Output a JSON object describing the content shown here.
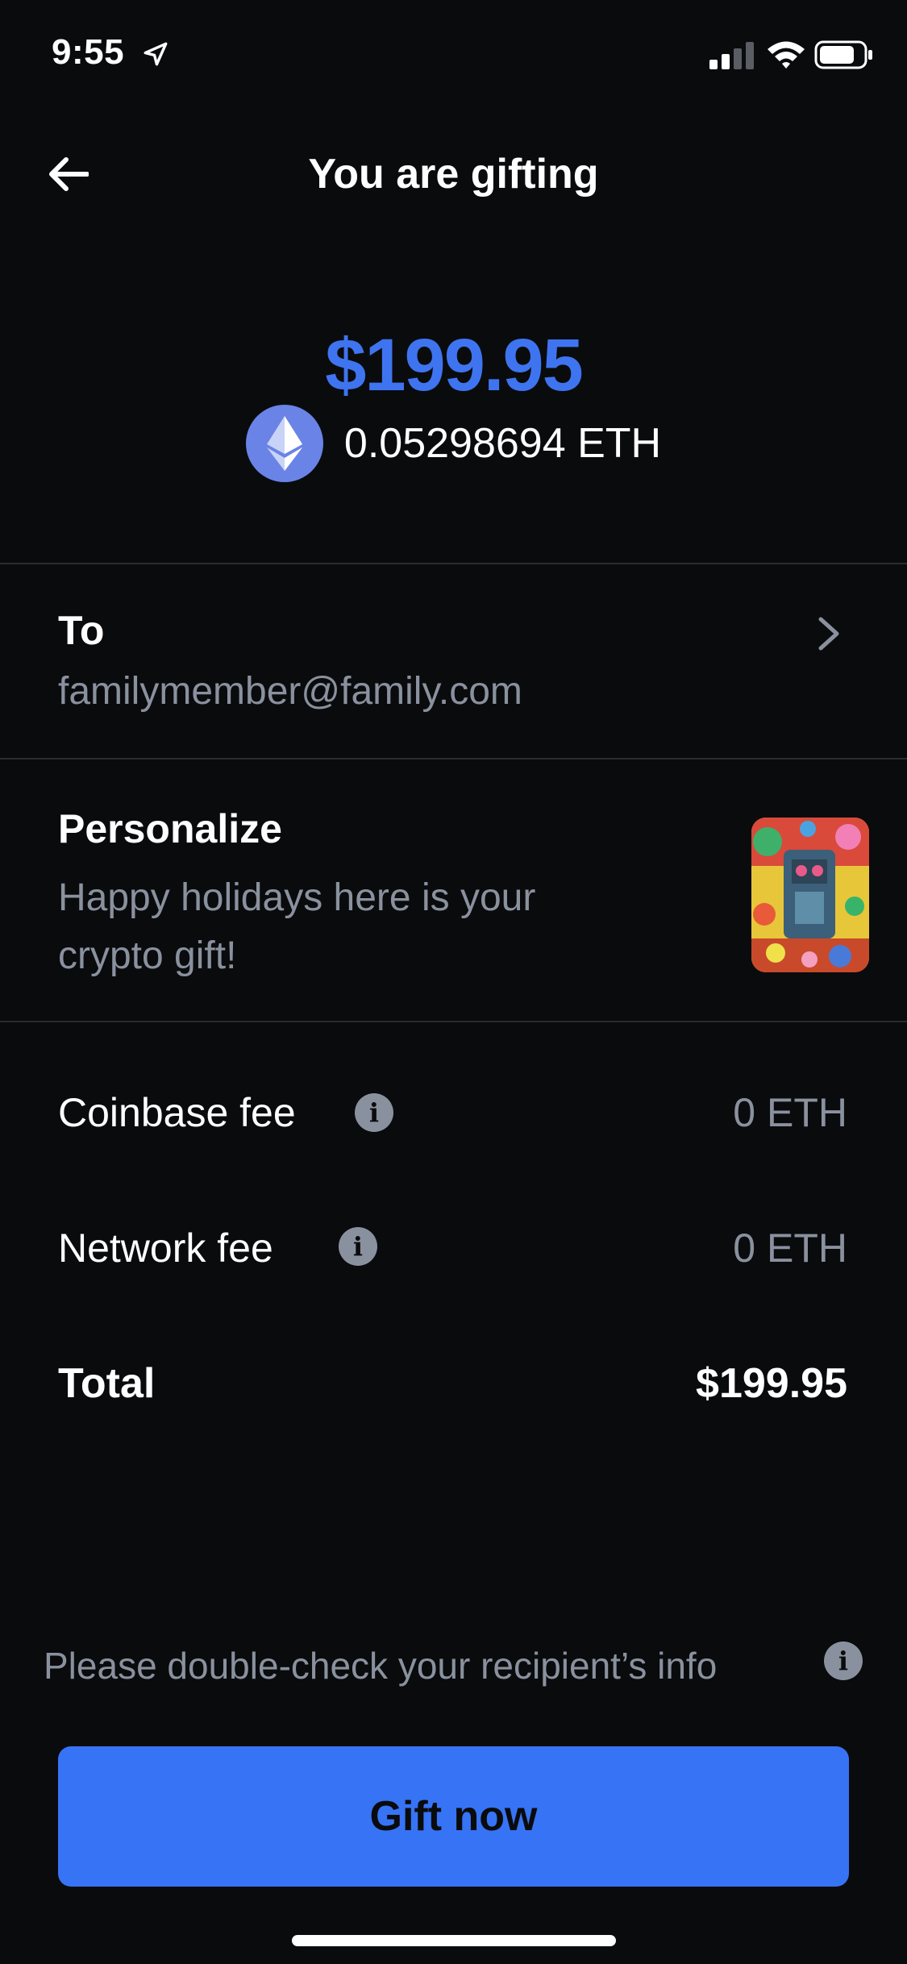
{
  "status_bar": {
    "time": "9:55"
  },
  "header": {
    "title": "You are gifting"
  },
  "amount": {
    "fiat": "$199.95",
    "crypto": "0.05298694 ETH",
    "crypto_icon": "ethereum-icon"
  },
  "recipient": {
    "label": "To",
    "value": "familymember@family.com"
  },
  "personalize": {
    "label": "Personalize",
    "message_line1": "Happy holidays here is your",
    "message_line2": "crypto gift!"
  },
  "fees": {
    "coinbase_label": "Coinbase fee",
    "coinbase_value": "0 ETH",
    "network_label": "Network fee",
    "network_value": "0 ETH",
    "total_label": "Total",
    "total_value": "$199.95"
  },
  "notice": {
    "text": "Please double-check your recipient’s info"
  },
  "actions": {
    "gift_now_label": "Gift now"
  },
  "colors": {
    "background": "#0a0b0d",
    "accent": "#3773f5",
    "fiat_amount": "#3f74f0",
    "eth_icon_bg": "#6a83e6",
    "secondary_text": "#8a919e"
  }
}
